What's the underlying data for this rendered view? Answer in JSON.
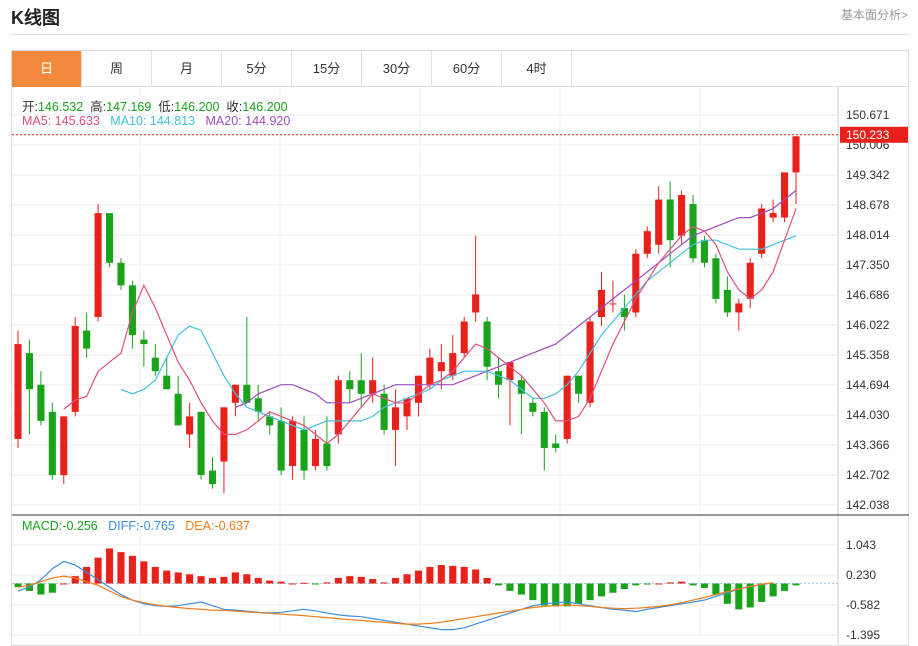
{
  "header": {
    "title": "K线图",
    "link": "基本面分析>"
  },
  "tabs": [
    {
      "label": "日",
      "active": true
    },
    {
      "label": "周",
      "active": false
    },
    {
      "label": "月",
      "active": false
    },
    {
      "label": "5分",
      "active": false
    },
    {
      "label": "15分",
      "active": false
    },
    {
      "label": "30分",
      "active": false
    },
    {
      "label": "60分",
      "active": false
    },
    {
      "label": "4时",
      "active": false
    }
  ],
  "ohlc_info": {
    "open_label": "开:",
    "open": "146.532",
    "high_label": "高:",
    "high": "147.169",
    "low_label": "低:",
    "low": "146.200",
    "close_label": "收:",
    "close": "146.200"
  },
  "ma_info": {
    "ma5_label": "MA5:",
    "ma5": "145.633",
    "ma10_label": "MA10:",
    "ma10": "144.813",
    "ma20_label": "MA20:",
    "ma20": "144.920"
  },
  "macd_info": {
    "macd_label": "MACD:",
    "macd": "-0.256",
    "diff_label": "DIFF:",
    "diff": "-0.765",
    "dea_label": "DEA:",
    "dea": "-0.637"
  },
  "colors": {
    "up": "#e8211b",
    "down": "#19a31b",
    "ma5": "#e0507a",
    "ma10": "#44c0e0",
    "ma20": "#a04cc0",
    "diff": "#3c8fe0",
    "dea": "#f07d1a",
    "price_tag": "#e8211b",
    "tab_active": "#f2893c",
    "info_green": "#19a31b"
  },
  "chart_data": [
    {
      "type": "candlestick",
      "price_ticks": [
        "150.671",
        "150.006",
        "149.342",
        "148.678",
        "148.014",
        "147.350",
        "146.686",
        "146.022",
        "145.358",
        "144.694",
        "144.030",
        "143.366",
        "142.702",
        "142.038"
      ],
      "ylim": [
        142.038,
        150.671
      ],
      "last_price": "150.233",
      "candles": [
        {
          "o": 143.5,
          "h": 145.9,
          "l": 143.3,
          "c": 145.6
        },
        {
          "o": 145.4,
          "h": 145.7,
          "l": 143.6,
          "c": 144.6
        },
        {
          "o": 144.7,
          "h": 145.0,
          "l": 143.8,
          "c": 143.9
        },
        {
          "o": 144.1,
          "h": 144.3,
          "l": 142.6,
          "c": 142.7
        },
        {
          "o": 142.7,
          "h": 144.0,
          "l": 142.5,
          "c": 144.0
        },
        {
          "o": 144.1,
          "h": 146.2,
          "l": 144.0,
          "c": 146.0
        },
        {
          "o": 145.9,
          "h": 146.3,
          "l": 145.3,
          "c": 145.5
        },
        {
          "o": 146.2,
          "h": 148.7,
          "l": 146.1,
          "c": 148.5
        },
        {
          "o": 148.5,
          "h": 148.5,
          "l": 147.3,
          "c": 147.4
        },
        {
          "o": 147.4,
          "h": 147.5,
          "l": 146.8,
          "c": 146.9
        },
        {
          "o": 146.9,
          "h": 147.0,
          "l": 145.5,
          "c": 145.8
        },
        {
          "o": 145.7,
          "h": 145.9,
          "l": 145.1,
          "c": 145.6
        },
        {
          "o": 145.3,
          "h": 145.6,
          "l": 144.9,
          "c": 145.0
        },
        {
          "o": 144.9,
          "h": 145.3,
          "l": 144.6,
          "c": 144.6
        },
        {
          "o": 144.5,
          "h": 144.9,
          "l": 143.8,
          "c": 143.8
        },
        {
          "o": 143.6,
          "h": 144.3,
          "l": 143.3,
          "c": 144.0
        },
        {
          "o": 144.1,
          "h": 144.1,
          "l": 142.6,
          "c": 142.7
        },
        {
          "o": 142.8,
          "h": 143.1,
          "l": 142.4,
          "c": 142.5
        },
        {
          "o": 143.0,
          "h": 144.2,
          "l": 142.3,
          "c": 144.2
        },
        {
          "o": 144.3,
          "h": 144.7,
          "l": 144.0,
          "c": 144.7
        },
        {
          "o": 144.7,
          "h": 146.2,
          "l": 144.3,
          "c": 144.3
        },
        {
          "o": 144.4,
          "h": 144.7,
          "l": 143.9,
          "c": 144.1
        },
        {
          "o": 144.0,
          "h": 144.1,
          "l": 143.6,
          "c": 143.8
        },
        {
          "o": 143.9,
          "h": 144.2,
          "l": 142.7,
          "c": 142.8
        },
        {
          "o": 142.9,
          "h": 144.0,
          "l": 142.6,
          "c": 143.9
        },
        {
          "o": 143.7,
          "h": 144.0,
          "l": 142.6,
          "c": 142.8
        },
        {
          "o": 142.9,
          "h": 143.7,
          "l": 142.8,
          "c": 143.5
        },
        {
          "o": 143.4,
          "h": 144.0,
          "l": 142.8,
          "c": 142.9
        },
        {
          "o": 143.6,
          "h": 144.9,
          "l": 143.4,
          "c": 144.8
        },
        {
          "o": 144.8,
          "h": 145.0,
          "l": 144.3,
          "c": 144.6
        },
        {
          "o": 144.8,
          "h": 145.4,
          "l": 144.2,
          "c": 144.5
        },
        {
          "o": 144.5,
          "h": 145.3,
          "l": 144.3,
          "c": 144.8
        },
        {
          "o": 144.5,
          "h": 144.7,
          "l": 143.6,
          "c": 143.7
        },
        {
          "o": 143.7,
          "h": 144.6,
          "l": 142.9,
          "c": 144.2
        },
        {
          "o": 144.0,
          "h": 144.4,
          "l": 143.7,
          "c": 144.4
        },
        {
          "o": 144.3,
          "h": 144.9,
          "l": 144.0,
          "c": 144.9
        },
        {
          "o": 144.7,
          "h": 145.5,
          "l": 144.6,
          "c": 145.3
        },
        {
          "o": 145.0,
          "h": 145.6,
          "l": 144.6,
          "c": 145.2
        },
        {
          "o": 144.9,
          "h": 145.8,
          "l": 144.8,
          "c": 145.4
        },
        {
          "o": 145.4,
          "h": 146.2,
          "l": 145.3,
          "c": 146.1
        },
        {
          "o": 146.3,
          "h": 148.0,
          "l": 146.1,
          "c": 146.7
        },
        {
          "o": 146.1,
          "h": 146.2,
          "l": 144.8,
          "c": 145.1
        },
        {
          "o": 145.0,
          "h": 145.3,
          "l": 144.4,
          "c": 144.7
        },
        {
          "o": 144.8,
          "h": 145.2,
          "l": 143.8,
          "c": 145.2
        },
        {
          "o": 144.8,
          "h": 144.9,
          "l": 143.6,
          "c": 144.5
        },
        {
          "o": 144.3,
          "h": 144.4,
          "l": 144.0,
          "c": 144.1
        },
        {
          "o": 144.1,
          "h": 144.2,
          "l": 142.8,
          "c": 143.3
        },
        {
          "o": 143.4,
          "h": 143.6,
          "l": 143.2,
          "c": 143.3
        },
        {
          "o": 143.5,
          "h": 144.9,
          "l": 143.4,
          "c": 144.9
        },
        {
          "o": 144.9,
          "h": 144.9,
          "l": 144.3,
          "c": 144.5
        },
        {
          "o": 144.3,
          "h": 146.2,
          "l": 144.2,
          "c": 146.1
        },
        {
          "o": 146.2,
          "h": 147.2,
          "l": 146.0,
          "c": 146.8
        },
        {
          "o": 146.5,
          "h": 147.0,
          "l": 146.3,
          "c": 146.5
        },
        {
          "o": 146.4,
          "h": 146.7,
          "l": 145.9,
          "c": 146.2
        },
        {
          "o": 146.3,
          "h": 147.7,
          "l": 146.2,
          "c": 147.6
        },
        {
          "o": 147.6,
          "h": 148.2,
          "l": 147.5,
          "c": 148.1
        },
        {
          "o": 147.8,
          "h": 149.1,
          "l": 147.6,
          "c": 148.8
        },
        {
          "o": 148.8,
          "h": 149.2,
          "l": 147.3,
          "c": 147.9
        },
        {
          "o": 148.0,
          "h": 149.0,
          "l": 147.8,
          "c": 148.9
        },
        {
          "o": 148.7,
          "h": 148.9,
          "l": 147.4,
          "c": 147.5
        },
        {
          "o": 147.9,
          "h": 148.0,
          "l": 147.3,
          "c": 147.4
        },
        {
          "o": 147.5,
          "h": 147.6,
          "l": 146.5,
          "c": 146.6
        },
        {
          "o": 146.8,
          "h": 147.1,
          "l": 146.2,
          "c": 146.3
        },
        {
          "o": 146.3,
          "h": 146.6,
          "l": 145.9,
          "c": 146.5
        },
        {
          "o": 146.6,
          "h": 147.5,
          "l": 146.4,
          "c": 147.4
        },
        {
          "o": 147.6,
          "h": 148.7,
          "l": 147.5,
          "c": 148.6
        },
        {
          "o": 148.4,
          "h": 148.8,
          "l": 148.3,
          "c": 148.5
        },
        {
          "o": 148.4,
          "h": 149.4,
          "l": 148.3,
          "c": 149.4
        },
        {
          "o": 149.4,
          "h": 150.2,
          "l": 148.7,
          "c": 150.2
        }
      ],
      "ma5": [
        null,
        null,
        null,
        null,
        144.16,
        144.36,
        144.44,
        145.0,
        145.2,
        145.4,
        146.3,
        146.9,
        146.4,
        145.8,
        145.2,
        144.8,
        144.3,
        143.9,
        143.6,
        143.6,
        143.7,
        143.9,
        144.1,
        144.0,
        143.9,
        143.8,
        143.6,
        143.4,
        143.6,
        143.9,
        144.2,
        144.5,
        144.4,
        144.3,
        144.3,
        144.5,
        144.7,
        144.8,
        145.0,
        145.3,
        145.6,
        145.5,
        145.3,
        145.1,
        144.9,
        144.6,
        144.3,
        143.9,
        143.9,
        144.0,
        144.4,
        145.0,
        145.6,
        146.1,
        146.6,
        147.0,
        147.4,
        147.7,
        148.0,
        148.2,
        148.1,
        147.8,
        147.2,
        146.8,
        146.6,
        146.8,
        147.2,
        147.9,
        148.6
      ],
      "ma10": [
        null,
        null,
        null,
        null,
        null,
        null,
        null,
        null,
        null,
        144.6,
        144.5,
        144.6,
        144.8,
        145.3,
        145.8,
        146.0,
        145.9,
        145.4,
        144.9,
        144.5,
        144.2,
        144.1,
        144.0,
        143.9,
        143.8,
        143.7,
        143.8,
        143.9,
        143.9,
        143.9,
        143.9,
        144.0,
        144.2,
        144.3,
        144.4,
        144.5,
        144.6,
        144.8,
        144.9,
        145.0,
        145.0,
        145.0,
        144.9,
        144.8,
        144.6,
        144.4,
        144.4,
        144.5,
        144.7,
        145.0,
        145.4,
        145.8,
        146.1,
        146.4,
        146.7,
        147.0,
        147.2,
        147.4,
        147.6,
        147.8,
        147.9,
        147.9,
        147.8,
        147.7,
        147.7,
        147.7,
        147.8,
        147.9,
        148.0
      ],
      "ma20": [
        null,
        null,
        null,
        null,
        null,
        null,
        null,
        null,
        null,
        null,
        null,
        null,
        null,
        null,
        null,
        null,
        null,
        null,
        null,
        144.2,
        144.3,
        144.5,
        144.6,
        144.7,
        144.7,
        144.6,
        144.5,
        144.3,
        144.3,
        144.3,
        144.4,
        144.5,
        144.6,
        144.7,
        144.7,
        144.7,
        144.7,
        144.7,
        144.7,
        144.8,
        144.9,
        145.0,
        145.1,
        145.2,
        145.3,
        145.4,
        145.5,
        145.6,
        145.8,
        146.0,
        146.2,
        146.4,
        146.6,
        146.8,
        147.0,
        147.2,
        147.4,
        147.6,
        147.8,
        148.0,
        148.1,
        148.2,
        148.3,
        148.4,
        148.4,
        148.5,
        148.6,
        148.8,
        149.0
      ]
    },
    {
      "type": "macd",
      "ticks": [
        "1.043",
        "0.230",
        "-0.582",
        "-1.395"
      ],
      "ylim": [
        -1.395,
        1.043
      ],
      "macd": [
        -0.1,
        -0.2,
        -0.3,
        -0.25,
        0.0,
        0.2,
        0.45,
        0.7,
        0.95,
        0.85,
        0.75,
        0.6,
        0.45,
        0.35,
        0.3,
        0.25,
        0.2,
        0.15,
        0.18,
        0.3,
        0.25,
        0.15,
        0.08,
        0.05,
        0.0,
        0.02,
        -0.02,
        0.03,
        0.15,
        0.2,
        0.18,
        0.12,
        0.03,
        0.15,
        0.25,
        0.35,
        0.45,
        0.5,
        0.48,
        0.45,
        0.38,
        0.15,
        -0.05,
        -0.2,
        -0.3,
        -0.45,
        -0.6,
        -0.62,
        -0.62,
        -0.55,
        -0.45,
        -0.35,
        -0.25,
        -0.15,
        -0.05,
        -0.02,
        0.0,
        0.03,
        0.05,
        -0.05,
        -0.12,
        -0.3,
        -0.55,
        -0.7,
        -0.65,
        -0.5,
        -0.35,
        -0.2,
        -0.05
      ],
      "diff": [
        -0.2,
        -0.1,
        0.1,
        0.4,
        0.6,
        0.5,
        0.3,
        0.1,
        -0.1,
        -0.3,
        -0.45,
        -0.55,
        -0.6,
        -0.62,
        -0.6,
        -0.55,
        -0.5,
        -0.6,
        -0.7,
        -0.72,
        -0.75,
        -0.78,
        -0.8,
        -0.78,
        -0.74,
        -0.7,
        -0.74,
        -0.8,
        -0.85,
        -0.88,
        -0.9,
        -0.95,
        -1.0,
        -1.05,
        -1.1,
        -1.15,
        -1.2,
        -1.25,
        -1.25,
        -1.2,
        -1.1,
        -1.0,
        -0.9,
        -0.8,
        -0.7,
        -0.6,
        -0.55,
        -0.52,
        -0.5,
        -0.55,
        -0.6,
        -0.65,
        -0.7,
        -0.72,
        -0.76,
        -0.7,
        -0.65,
        -0.6,
        -0.55,
        -0.5,
        -0.45,
        -0.35,
        -0.25,
        -0.15,
        -0.08,
        -0.03,
        0.02
      ],
      "dea": [
        -0.1,
        -0.05,
        0.05,
        0.15,
        0.2,
        0.15,
        0.05,
        -0.05,
        -0.2,
        -0.35,
        -0.45,
        -0.52,
        -0.58,
        -0.62,
        -0.65,
        -0.68,
        -0.7,
        -0.72,
        -0.73,
        -0.75,
        -0.77,
        -0.79,
        -0.81,
        -0.83,
        -0.85,
        -0.87,
        -0.9,
        -0.92,
        -0.95,
        -0.98,
        -1.0,
        -1.03,
        -1.05,
        -1.08,
        -1.1,
        -1.1,
        -1.08,
        -1.05,
        -1.0,
        -0.95,
        -0.9,
        -0.85,
        -0.8,
        -0.75,
        -0.7,
        -0.65,
        -0.62,
        -0.6,
        -0.58,
        -0.6,
        -0.62,
        -0.65,
        -0.67,
        -0.68,
        -0.67,
        -0.65,
        -0.62,
        -0.58,
        -0.52,
        -0.45,
        -0.38,
        -0.3,
        -0.22,
        -0.15,
        -0.08,
        -0.02,
        0.02
      ]
    }
  ]
}
